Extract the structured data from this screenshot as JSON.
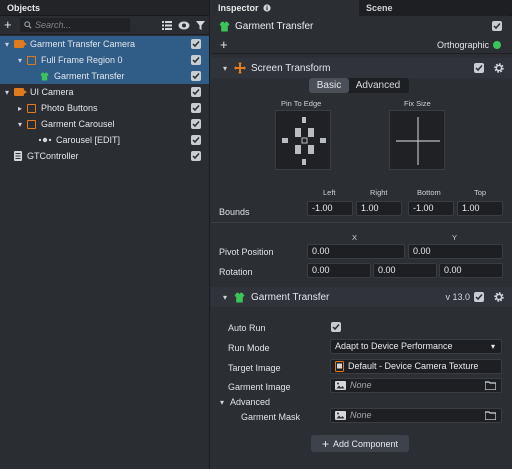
{
  "left_panel": {
    "tab_label": "Objects",
    "search_placeholder": "Search...",
    "tree": [
      {
        "label": "Garment Transfer Camera",
        "checked": true
      },
      {
        "label": "Full Frame Region 0",
        "checked": true
      },
      {
        "label": "Garment Transfer",
        "checked": true
      },
      {
        "label": "UI Camera",
        "checked": true
      },
      {
        "label": "Photo Buttons",
        "checked": true
      },
      {
        "label": "Garment Carousel",
        "checked": true
      },
      {
        "label": "Carousel [EDIT]",
        "checked": true
      },
      {
        "label": "GTController",
        "checked": true
      }
    ]
  },
  "right_panel": {
    "tabs": [
      "Inspector",
      "Scene"
    ],
    "object_name": "Garment Transfer",
    "orthographic_label": "Orthographic",
    "screen_transform": {
      "title": "Screen Transform",
      "toggle": [
        "Basic",
        "Advanced"
      ],
      "pin_to_edge_label": "Pin To Edge",
      "fix_size_label": "Fix Size",
      "bounds": {
        "label": "Bounds",
        "headers": [
          "Left",
          "Right",
          "Bottom",
          "Top"
        ],
        "values": [
          "-1.00",
          "1.00",
          "-1.00",
          "1.00"
        ]
      },
      "pivot": {
        "label": "Pivot Position",
        "headers": [
          "X",
          "Y"
        ],
        "values": [
          "0.00",
          "0.00"
        ]
      },
      "rotation": {
        "label": "Rotation",
        "values": [
          "0.00",
          "0.00",
          "0.00"
        ]
      }
    },
    "garment_transfer": {
      "title": "Garment Transfer",
      "version": "v 13.0",
      "auto_run_label": "Auto Run",
      "run_mode_label": "Run Mode",
      "run_mode_value": "Adapt to Device Performance",
      "target_image_label": "Target Image",
      "target_image_value": "Default - Device Camera Texture",
      "garment_image_label": "Garment Image",
      "garment_image_value": "None",
      "advanced_label": "Advanced",
      "garment_mask_label": "Garment Mask",
      "garment_mask_value": "None"
    },
    "add_component_label": "Add Component"
  },
  "colors": {
    "selection": "#2f5d87",
    "accent_orange": "#e07b1c",
    "accent_green": "#3cc45a",
    "panel_bg": "#2b2e33"
  }
}
